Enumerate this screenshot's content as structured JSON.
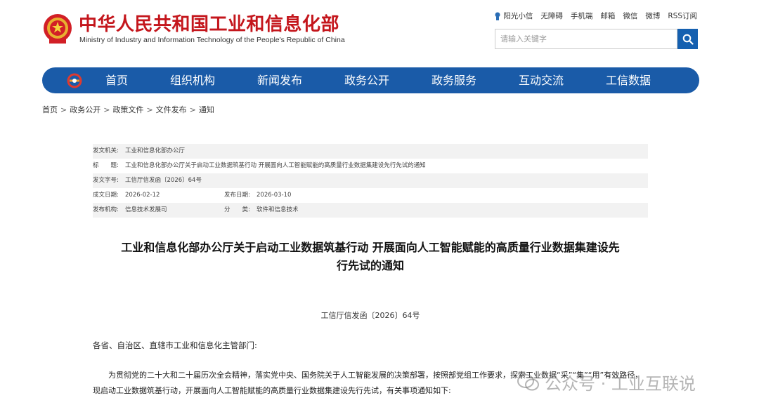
{
  "header": {
    "title": "中华人民共和国工业和信息化部",
    "subtitle": "Ministry of Industry and Information Technology of the People's Republic of China",
    "toplinks": [
      "阳光小信",
      "无障碍",
      "手机端",
      "邮箱",
      "微信",
      "微博",
      "RSS订阅"
    ],
    "search_placeholder": "请输入关键字"
  },
  "nav": {
    "items": [
      "首页",
      "组织机构",
      "新闻发布",
      "政务公开",
      "政务服务",
      "互动交流",
      "工信数据"
    ]
  },
  "breadcrumb": [
    "首页",
    "政务公开",
    "政策文件",
    "文件发布",
    "通知"
  ],
  "meta": {
    "issuer_label": "发文机关:",
    "issuer": "工业和信息化部办公厅",
    "title_label": "标　　题:",
    "title": "工业和信息化部办公厅关于启动工业数据筑基行动 开展面向人工智能赋能的高质量行业数据集建设先行先试的通知",
    "docno_label": "发文字号:",
    "docno": "工信厅信发函〔2026〕64号",
    "created_label": "成文日期:",
    "created": "2026-02-12",
    "published_label": "发布日期:",
    "published": "2026-03-10",
    "org_label": "发布机构:",
    "org": "信息技术发展司",
    "category_label": "分　　类:",
    "category": "软件和信息技术"
  },
  "document": {
    "title_line1": "工业和信息化部办公厅关于启动工业数据筑基行动 开展面向人工智能赋能的高质量行业数据集建设先",
    "title_line2": "行先试的通知",
    "number": "工信厅信发函〔2026〕64号",
    "addressee": "各省、自治区、直辖市工业和信息化主管部门:",
    "para1": "为贯彻党的二十大和二十届历次全会精神，落实党中央、国务院关于人工智能发展的决策部署，按照部党组工作要求，探索工业数据“采”“集”“用”有效路径，现启动工业数据筑基行动，开展面向人工智能赋能的高质量行业数据集建设先行先试，有关事项通知如下:"
  },
  "watermark": "公众号 · 工业互联说",
  "colors": {
    "brand_red": "#c4161c",
    "nav_blue": "#1a5ba8",
    "search_blue": "#1560b0"
  }
}
